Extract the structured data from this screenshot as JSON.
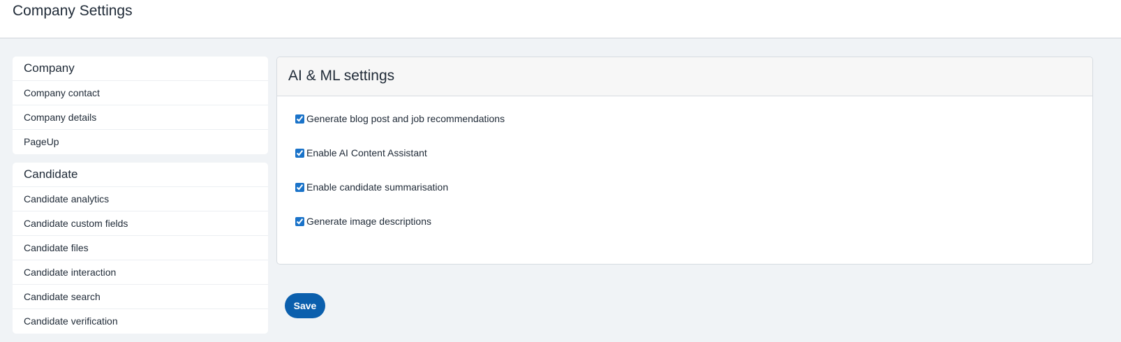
{
  "header": {
    "title": "Company Settings"
  },
  "sidebar": {
    "groups": [
      {
        "title": "Company",
        "items": [
          "Company contact",
          "Company details",
          "PageUp"
        ]
      },
      {
        "title": "Candidate",
        "items": [
          "Candidate analytics",
          "Candidate custom fields",
          "Candidate files",
          "Candidate interaction",
          "Candidate search",
          "Candidate verification"
        ]
      }
    ]
  },
  "main": {
    "panel_title": "AI & ML settings",
    "options": [
      {
        "label": "Generate blog post and job recommendations",
        "checked": true
      },
      {
        "label": "Enable AI Content Assistant",
        "checked": true
      },
      {
        "label": "Enable candidate summarisation",
        "checked": true
      },
      {
        "label": "Generate image descriptions",
        "checked": true
      }
    ],
    "save_label": "Save"
  },
  "colors": {
    "accent": "#0b5fad",
    "background": "#f0f3f6"
  }
}
